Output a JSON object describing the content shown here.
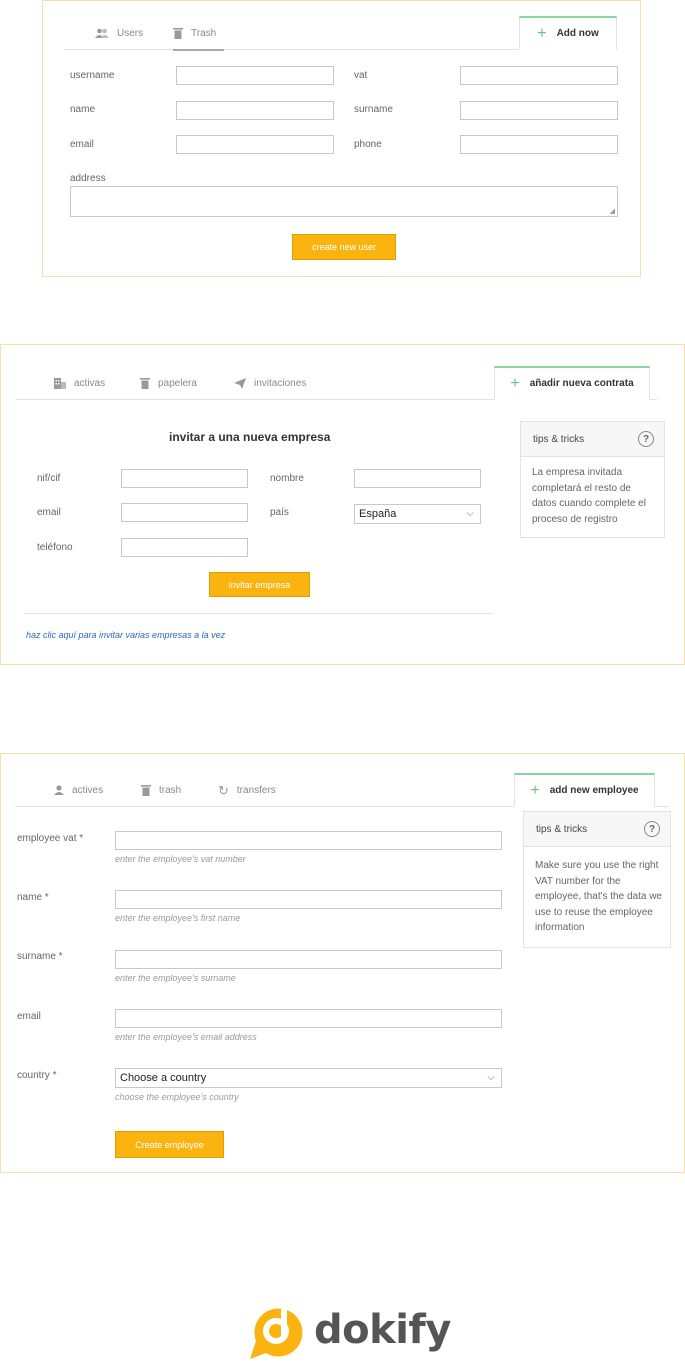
{
  "users_panel": {
    "tabs": [
      {
        "label": "Users",
        "icon": "users-icon"
      },
      {
        "label": "Trash",
        "icon": "trash-icon"
      }
    ],
    "add_tab": {
      "label": "Add now"
    },
    "fields": {
      "username": "username",
      "vat": "vat",
      "name": "name",
      "surname": "surname",
      "email": "email",
      "phone": "phone",
      "address": "address"
    },
    "submit_label": "create new user"
  },
  "company_panel": {
    "tabs": [
      {
        "label": "activas",
        "icon": "building-icon"
      },
      {
        "label": "papelera",
        "icon": "trash-icon"
      },
      {
        "label": "invitaciones",
        "icon": "paper-plane-icon"
      }
    ],
    "add_tab": {
      "label": "añadir nueva contrata"
    },
    "title": "invitar a una nueva empresa",
    "fields": {
      "nifcif": "nif/cif",
      "nombre": "nombre",
      "email": "email",
      "pais": "país",
      "telefono": "teléfono"
    },
    "country_value": "España",
    "submit_label": "invitar empresa",
    "bulk_link": "haz clic aquí para invitar varias empresas a la vez",
    "tips": {
      "title": "tips & tricks",
      "body": "La empresa invitada completará el resto de datos cuando complete el proceso de registro"
    }
  },
  "employee_panel": {
    "tabs": [
      {
        "label": "actives",
        "icon": "person-icon"
      },
      {
        "label": "trash",
        "icon": "trash-icon"
      },
      {
        "label": "transfers",
        "icon": "refresh-icon"
      }
    ],
    "add_tab": {
      "label": "add new employee"
    },
    "fields": [
      {
        "label": "employee vat *",
        "hint": "enter the employee's vat number"
      },
      {
        "label": "name *",
        "hint": "enter the employee's first name"
      },
      {
        "label": "surname *",
        "hint": "enter the employee's surname"
      },
      {
        "label": "email",
        "hint": "enter the employee's email address"
      },
      {
        "label": "country *",
        "hint": "choose the employee's country"
      }
    ],
    "country_placeholder": "Choose a country",
    "submit_label": "Create employee",
    "tips": {
      "title": "tips & tricks",
      "body": "Make sure you use the right VAT number for the employee, that's the data we use to reuse the employee information"
    }
  },
  "brand": {
    "name": "dokify",
    "colors": {
      "accent": "#fbb40f",
      "add_tab_border": "#8ed39d",
      "link": "#2a6ab5",
      "panel_border": "#f6dfaa"
    }
  }
}
